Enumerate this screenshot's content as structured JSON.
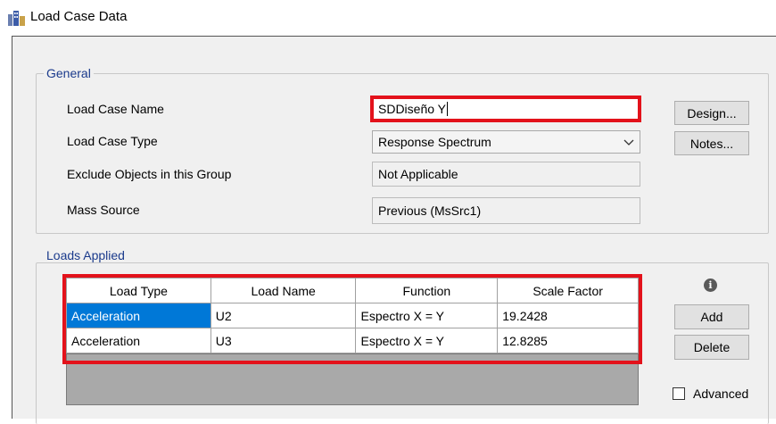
{
  "window": {
    "title": "Load Case Data"
  },
  "general": {
    "legend": "General",
    "load_case_name_label": "Load Case Name",
    "load_case_name_value": "SDDiseño Y",
    "load_case_type_label": "Load Case Type",
    "load_case_type_value": "Response Spectrum",
    "exclude_label": "Exclude Objects in this Group",
    "exclude_value": "Not Applicable",
    "mass_source_label": "Mass Source",
    "mass_source_value": "Previous (MsSrc1)"
  },
  "buttons": {
    "design": "Design...",
    "notes": "Notes...",
    "add": "Add",
    "delete": "Delete"
  },
  "loads_applied": {
    "legend": "Loads Applied",
    "headers": [
      "Load Type",
      "Load Name",
      "Function",
      "Scale Factor"
    ],
    "rows": [
      [
        "Acceleration",
        "U2",
        "Espectro X = Y",
        "19.2428"
      ],
      [
        "Acceleration",
        "U3",
        "Espectro X = Y",
        "12.8285"
      ]
    ]
  },
  "advanced": {
    "label": "Advanced",
    "checked": false
  },
  "icons": {
    "app": "building-icon",
    "info": "info-icon",
    "dropdown": "chevron-down-icon"
  },
  "colors": {
    "highlight": "#e3121b",
    "selection": "#0078d7",
    "legend": "#1a3a8c"
  }
}
